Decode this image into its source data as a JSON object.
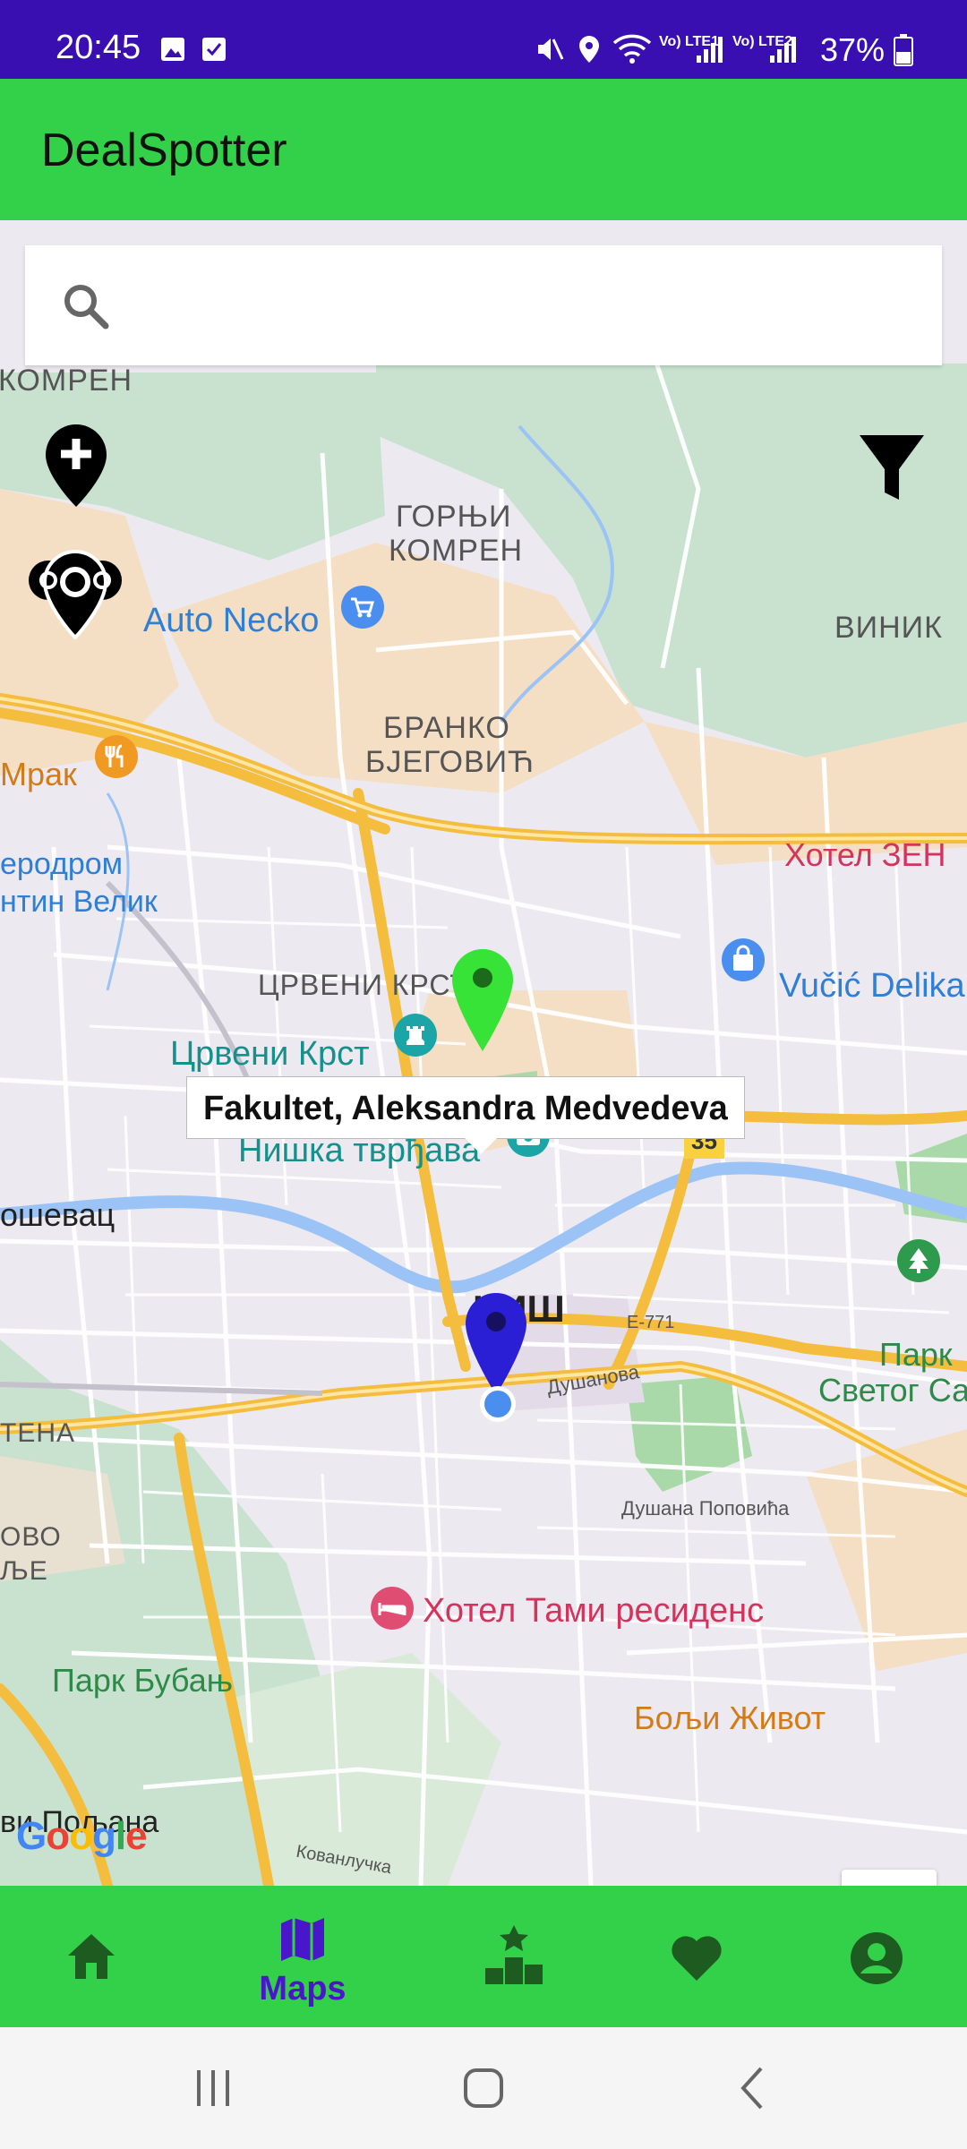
{
  "status_bar": {
    "time": "20:45",
    "battery": "37%",
    "network1": "Vo) LTE1",
    "network2": "Vo) LTE2",
    "icons": [
      "image-icon",
      "check-icon",
      "mute-icon",
      "location-icon",
      "wifi-icon",
      "signal-icon",
      "battery-icon"
    ]
  },
  "app_bar": {
    "title": "DealSpotter"
  },
  "search": {
    "value": "",
    "placeholder": ""
  },
  "map": {
    "labels": {
      "komren": "КОМРЕН",
      "gornji_komren_1": "ГОРЊИ",
      "gornji_komren_2": "КОМРЕН",
      "vinik": "ВИНИК",
      "auto_necko": "Auto Necko",
      "branko_1": "БРАНКО",
      "branko_2": "БЈЕГОВИЋ",
      "mrak": "Мрак",
      "aerodrom_1": "еродром",
      "aerodrom_2": "нтин Велик",
      "hotel_zen": "Хотел ЗЕН",
      "crveni_krst_area": "ЦРВЕНИ КРСТ",
      "crveni_krst": "Црвени Крст",
      "vucic": "Vučić Delika",
      "niska_tvrdjava": "Нишка тврђава",
      "road_35": "35",
      "sevac": "ошевац",
      "nis": "НИШ",
      "e771": "E-771",
      "dusanova": "Душанова",
      "park_svetog_1": "Парк",
      "park_svetog_2": "Светог Са",
      "tena": "ТЕНА",
      "ovo_1": "ОВО",
      "ovo_2": "ЉЕ",
      "dusana_popovica": "Душана Поповића",
      "hotel_tami": "Хотел Тами ресиденс",
      "park_bubanj": "Парк Бубањ",
      "bolji_zivot": "Бољи Живот",
      "poljana": "ви Пољана",
      "kovanlucka": "Кованлучка"
    },
    "info_window": "Fakultet, Aleksandra Medvedeva",
    "google_logo": "Google",
    "colors": {
      "selected_marker": "#36e336",
      "user_marker": "#2b1fd6",
      "my_location": "#4a8ef0",
      "road_major": "#f4bd3e",
      "water": "#9cc3f5",
      "park": "#c6e6c9"
    }
  },
  "bottom_nav": {
    "items": [
      {
        "icon": "home-icon",
        "label": ""
      },
      {
        "icon": "map-icon",
        "label": "Maps",
        "active": true
      },
      {
        "icon": "ranking-icon",
        "label": ""
      },
      {
        "icon": "heart-icon",
        "label": ""
      },
      {
        "icon": "account-icon",
        "label": ""
      }
    ],
    "active_color": "#4a16c9",
    "inactive_color": "#1d5b20"
  }
}
